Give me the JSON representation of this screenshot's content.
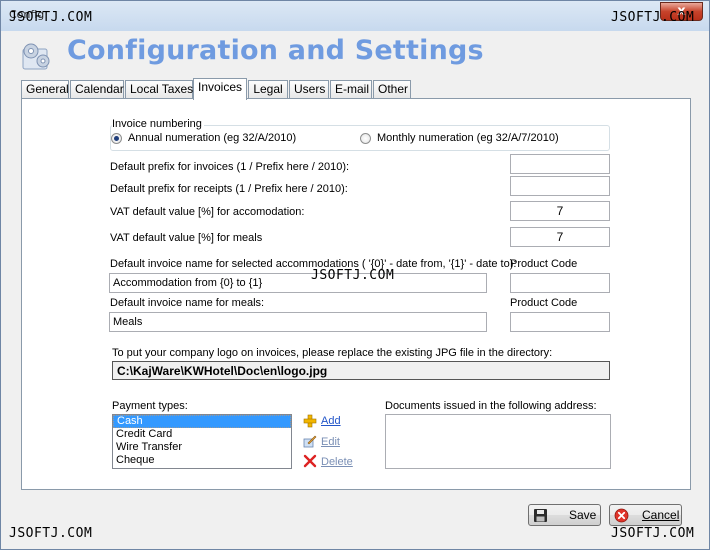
{
  "window": {
    "title": "Config",
    "close_glyph": "x"
  },
  "watermarks": [
    "JSOFTJ.COM",
    "JSOFTJ.COM",
    "JSOFTJ.COM",
    "JSOFTJ.COM",
    "JSOFTJ.COM"
  ],
  "header": {
    "title": "Configuration and Settings",
    "icon": "settings-gears-icon"
  },
  "tabs": [
    {
      "label": "General"
    },
    {
      "label": "Calendar"
    },
    {
      "label": "Local Taxes"
    },
    {
      "label": "Invoices",
      "active": true
    },
    {
      "label": "Legal"
    },
    {
      "label": "Users"
    },
    {
      "label": "E-mail"
    },
    {
      "label": "Other"
    }
  ],
  "invoice_numbering": {
    "legend": "Invoice numbering",
    "annual_label": "Annual numeration (eg 32/A/2010)",
    "monthly_label": "Monthly numeration (eg 32/A/7/2010)",
    "selected": "annual"
  },
  "fields": {
    "prefix_invoices_label": "Default prefix for invoices (1 / Prefix here / 2010):",
    "prefix_invoices_value": "",
    "prefix_receipts_label": "Default prefix for receipts (1 /  Prefix here / 2010):",
    "prefix_receipts_value": "",
    "vat_accom_label": "VAT default value [%] for accomodation:",
    "vat_accom_value": "7",
    "vat_meals_label": "VAT default value [%] for meals",
    "vat_meals_value": "7",
    "accom_name_label": "Default invoice name for selected accommodations ( '{0}' - date from, '{1}' - date to):",
    "accom_name_value": "Accommodation from {0} to {1}",
    "accom_product_code_label": "Product Code",
    "accom_product_code_value": "",
    "meals_name_label": "Default invoice name for meals:",
    "meals_name_value": "Meals",
    "meals_product_code_label": "Product Code",
    "meals_product_code_value": ""
  },
  "logo": {
    "instruction": "To put your company logo on invoices, please replace the existing JPG file in the directory:",
    "path": "C:\\KajWare\\KWHotel\\Doc\\en\\logo.jpg"
  },
  "payment": {
    "label": "Payment types:",
    "items": [
      "Cash",
      "Credit Card",
      "Wire Transfer",
      "Cheque"
    ],
    "selected_index": 0,
    "add_label": "Add",
    "edit_label": "Edit",
    "delete_label": "Delete"
  },
  "address": {
    "label": "Documents issued in the following address:",
    "value": ""
  },
  "buttons": {
    "save": "Save",
    "cancel": "Cancel"
  },
  "colors": {
    "title_accent": "#6f9be0",
    "selection": "#3399ff",
    "link": "#2255c8"
  }
}
